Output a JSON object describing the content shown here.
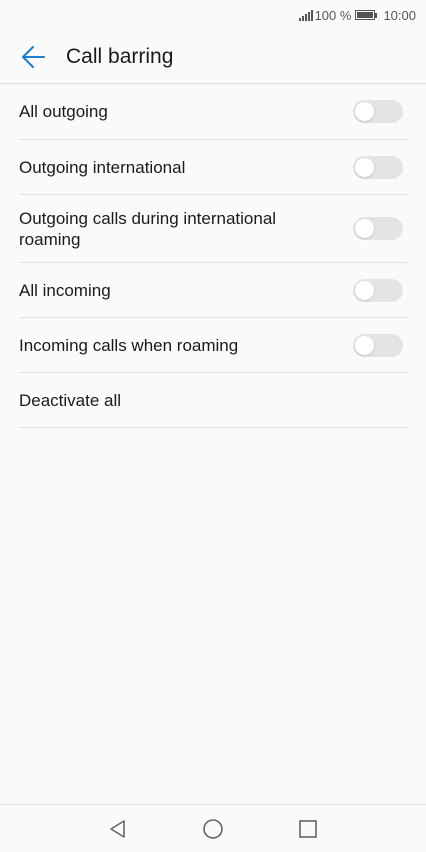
{
  "status_bar": {
    "battery_text": "100 %",
    "time": "10:00"
  },
  "header": {
    "title": "Call barring",
    "back_icon": "arrow-back-icon",
    "accent_color": "#1a7fd6"
  },
  "settings": [
    {
      "label": "All outgoing",
      "toggle": false
    },
    {
      "label": "Outgoing international",
      "toggle": false
    },
    {
      "label": "Outgoing calls during international roaming",
      "toggle": false
    },
    {
      "label": "All incoming",
      "toggle": false
    },
    {
      "label": "Incoming calls when roaming",
      "toggle": false
    },
    {
      "label": "Deactivate all"
    }
  ],
  "nav_bar": {
    "back": "triangle-back-icon",
    "home": "circle-home-icon",
    "recents": "square-recents-icon"
  }
}
